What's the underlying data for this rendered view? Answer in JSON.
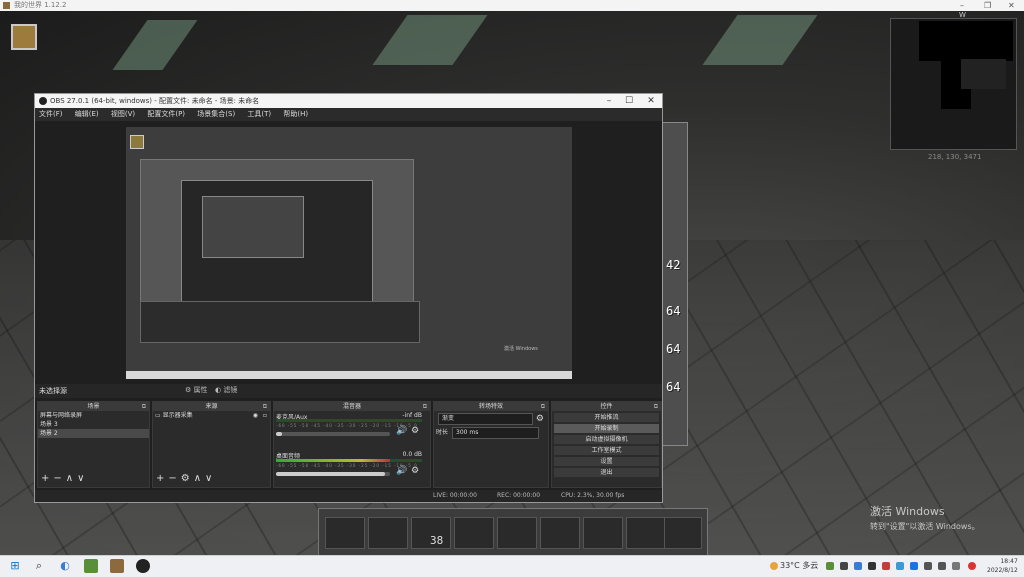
{
  "game": {
    "title": "我的世界 1.12.2",
    "coords": "218, 130, 3471",
    "compass": "W",
    "slot_counts": [
      "42",
      "64",
      "64",
      "64"
    ],
    "hotbar_count": "38",
    "activate_title": "激活 Windows",
    "activate_sub": "转到\"设置\"以激活 Windows。"
  },
  "obs": {
    "title": "OBS 27.0.1 (64-bit, windows) - 配置文件: 未命名 - 场景: 未命名",
    "menu": [
      "文件(F)",
      "编辑(E)",
      "视图(V)",
      "配置文件(P)",
      "场景集合(S)",
      "工具(T)",
      "帮助(H)"
    ],
    "status_label": "未选择源",
    "props_btn": "属性",
    "filters_btn": "滤镜",
    "docks": {
      "scenes": {
        "title": "场景",
        "items": [
          "屏幕与网络录屏",
          "场景 3",
          "场景 2"
        ]
      },
      "sources": {
        "title": "来源",
        "items": [
          "显示器采集"
        ]
      },
      "mixer": {
        "title": "混音器",
        "tracks": [
          {
            "name": "麦克风/Aux",
            "db": "-inf dB",
            "level": 0.0,
            "volume": 0.05
          },
          {
            "name": "桌面音频",
            "db": "0.0 dB",
            "level": 0.78,
            "volume": 0.96
          }
        ],
        "scale": "-60 -55 -50 -45 -40 -35 -30 -25 -20 -15 -10 -5 0"
      },
      "transitions": {
        "title": "转场特效",
        "type": "渐变",
        "duration_label": "时长",
        "duration": "300 ms"
      },
      "controls": {
        "title": "控件",
        "buttons": [
          "开始推流",
          "开始录制",
          "启动虚拟摄像机",
          "工作室模式",
          "设置",
          "退出"
        ]
      }
    },
    "footer": {
      "live": "LIVE: 00:00:00",
      "rec": "REC: 00:00:00",
      "cpu": "CPU: 2.3%, 30.00 fps"
    }
  },
  "taskbar": {
    "weather": "33°C 多云",
    "time": "18:47",
    "date": "2022/8/12"
  }
}
